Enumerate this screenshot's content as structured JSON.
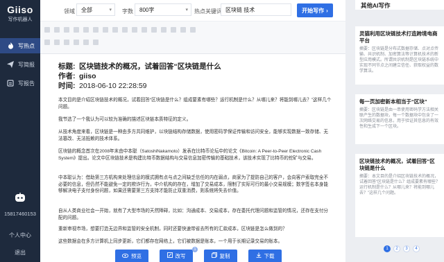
{
  "app": {
    "brand": "Giiso",
    "subtitle": "写作机器人"
  },
  "sidebar": {
    "items": [
      {
        "label": "写热点",
        "icon": "flame-icon",
        "active": true
      },
      {
        "label": "写简报",
        "icon": "paper-plane-icon",
        "active": false
      },
      {
        "label": "写报告",
        "icon": "report-icon",
        "active": false
      }
    ],
    "phone": "15817460153",
    "personal_center": "个人中心",
    "logout": "退出"
  },
  "form": {
    "field_label": "领域",
    "field_value": "全部",
    "words_label": "字数",
    "words_value": "800字",
    "keywords_label": "热点关键词",
    "keywords_value": "区块链 技术",
    "start_button": "开始写作"
  },
  "article": {
    "title_key": "标题:",
    "title": "区块链技术的概况，试着回答“区块链是什么",
    "author_key": "作者:",
    "author": "giiso",
    "time_key": "时间:",
    "time": "2018-06-10 22:28:59",
    "paragraphs": [
      "本文目的是介绍区块链技术的概况，试着回答“区块链是什么？组成要素有哪些？运行机制是什么？从哪儿来？将能到哪儿去？”这样几个问题。",
      "我节选了一个我认为可以较为准确的描述区块链本质特征的定义。",
      "从技术角度来看，区块链是一种由多方共同维护，以块链结构存储数据，使用密码学保证传输和访问安全，能够实现数据一致存储、无法篡改、无法抵赖的技术体系。",
      "区块链的概念首次在2008年末由中本聪（SatoshiNakamoto）发表在比特币论坛中的论文《Bitcoin: A Peer-to-Peer Electronic Cash System》提出。论文中区块链技术是构建比特币数据结构与交易信息加密传输的基础技术，该技术实现了比特币的挖矿与交易。",
      "中本聪认为：借助第三方机构来处理信息的模式拥有点与点之间缺乏信任的内在弱点，商家为了提防自己的客户，会向客户索取完全不必要的信息，但仍然不能避免一定的欺诈行为，中介机构的存在，增加了交易成本，限制了实际可行的最小交易规模；数字签名本身能够解决电子支付身份问题，如果还需要第三方支持才能防止双重消费，则系统将失去价值。",
      "自从人类商业社会一开始，就有了大型市场的天然障碍，比如：沟通成本、交易成本，存在委托代理问题和监管的情况，还存在支付分配的问题。",
      "重新审视市场，想要打造无边界和监管的安全机制，同时还要快速带省去所有的汇款成本，区块链是怎么做到的？",
      "这些数据会在多方计算机上同步更新，它们都存在网络上，它们被数据是账本，一个用于长期记录交易的账本。"
    ]
  },
  "actions": [
    {
      "label": "预览",
      "icon": "eye-icon"
    },
    {
      "label": "改写",
      "icon": "edit-icon",
      "badge": "1"
    },
    {
      "label": "复制",
      "icon": "copy-icon"
    },
    {
      "label": "下载",
      "icon": "download-icon"
    }
  ],
  "right_panel": {
    "title": "其他AI写作",
    "cards": [
      {
        "title": "灵猫利用区块链技术打造跨境电商平台",
        "summary": "摘要：区块链是分布式数据存储、点对点传输、共识机制、加密算法等计算机技术的新型应用模式。所谓共识机制是区块链系统中实现不同节点之间建立信任、获取权益的数学算法。"
      },
      {
        "title": "每一页加密新本相当于“区块”",
        "summary": "摘要：区块链是由一串使用密码学方法相关联产生的数据块，每一个数据块中包含了一次网络交易的信息，用于验证其信息的有效性和生成下一个区块。"
      },
      {
        "title": "区块链技术的概况，试着回答“区块链是什么",
        "summary": "摘要：本文目的是介绍区块链技术的概况，试着回答“区块链是什么？组成要素有哪些？运行机制是什么？从哪儿来？将能到哪儿去？”这样几个问题。"
      }
    ],
    "pages": [
      "1",
      "2",
      "3",
      "4"
    ]
  },
  "colors": {
    "sidebar": "#1e2a3d",
    "active": "#2e4a85",
    "accent": "#2f6fe4"
  }
}
